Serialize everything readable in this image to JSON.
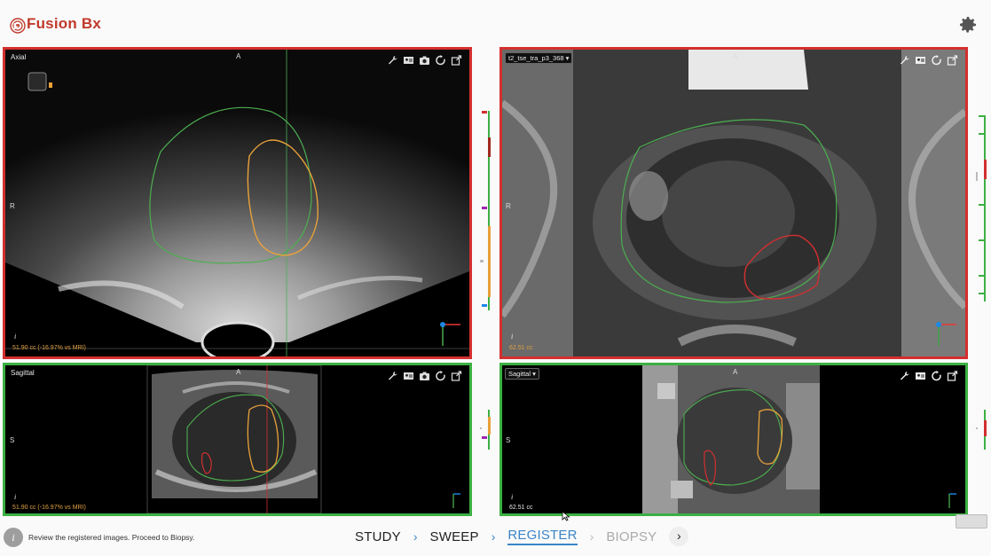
{
  "app": {
    "title": "Fusion Bx"
  },
  "viewports": {
    "axial_us": {
      "label": "Axial",
      "top": "A",
      "left": "R",
      "volume": "51.90 cc (-16.97% vs MRI)",
      "info": "i"
    },
    "axial_mri": {
      "series": "t2_tse_tra_p3_368",
      "top": "A",
      "left": "R",
      "volume": "62.51 cc",
      "info": "i"
    },
    "sag_us": {
      "label": "Sagittal",
      "top": "A",
      "left": "S",
      "volume": "51.90 cc (-16.97% vs MRI)",
      "info": "i"
    },
    "sag_mri": {
      "label": "Sagittal",
      "top": "A",
      "left": "S",
      "volume": "62.51 cc",
      "info": "i"
    }
  },
  "status": {
    "icon": "i",
    "message": "Review the registered images. Proceed to Biopsy."
  },
  "workflow": {
    "steps": [
      {
        "label": "STUDY",
        "state": "done"
      },
      {
        "label": "SWEEP",
        "state": "done"
      },
      {
        "label": "REGISTER",
        "state": "active"
      },
      {
        "label": "BIOPSY",
        "state": "disabled"
      }
    ],
    "next": "›"
  },
  "colors": {
    "active_border": "#d32f2f",
    "inactive_border": "#3cb043",
    "prostate_contour": "#4caf50",
    "us_lesion": "#e8a13a",
    "mri_lesion": "#d32f2f",
    "active_step": "#3a85c8"
  },
  "icons": [
    "wrench-icon",
    "contact-card-icon",
    "camera-icon",
    "refresh-icon",
    "expand-icon",
    "gear-icon",
    "settings-icon"
  ]
}
